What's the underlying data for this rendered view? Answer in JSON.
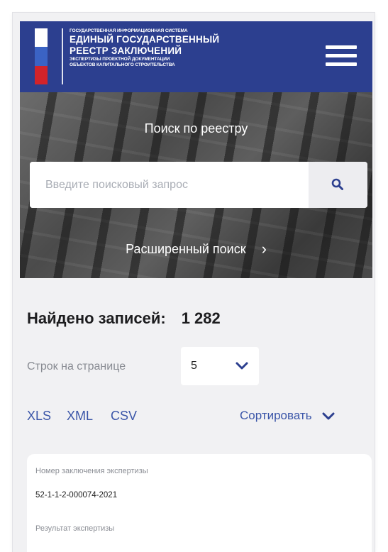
{
  "header": {
    "line1": "ГОСУДАРСТВЕННАЯ ИНФОРМАЦИОННАЯ СИСТЕМА",
    "line2": "ЕДИНЫЙ ГОСУДАРСТВЕННЫЙ",
    "line3": "РЕЕСТР ЗАКЛЮЧЕНИЙ",
    "line4": "ЭКСПЕРТИЗЫ ПРОЕКТНОЙ ДОКУМЕНТАЦИИ",
    "line5": "ОБЪЕКТОВ КАПИТАЛЬНОГО СТРОИТЕЛЬСТВА",
    "menu_icon": "hamburger-menu-icon"
  },
  "hero": {
    "title": "Поиск по реестру",
    "search_placeholder": "Введите поисковый запрос",
    "search_icon": "search-icon",
    "advanced_search": "Расширенный поиск",
    "advanced_icon": "chevron-right-icon"
  },
  "results": {
    "found_label": "Найдено записей:",
    "found_count": "1 282",
    "rows_label": "Строк на странице",
    "rows_value": "5",
    "export": [
      "XLS",
      "XML",
      "CSV"
    ],
    "sort_label": "Сортировать"
  },
  "card": {
    "field1_label": "Номер заключения экспертизы",
    "field1_value": "52-1-1-2-000074-2021",
    "field2_label": "Результат экспертизы"
  },
  "colors": {
    "header_bg": "#2c3f8f",
    "accent": "#3a55a8",
    "flag_white": "#ffffff",
    "flag_blue": "#3b63c4",
    "flag_red": "#d2232a"
  }
}
